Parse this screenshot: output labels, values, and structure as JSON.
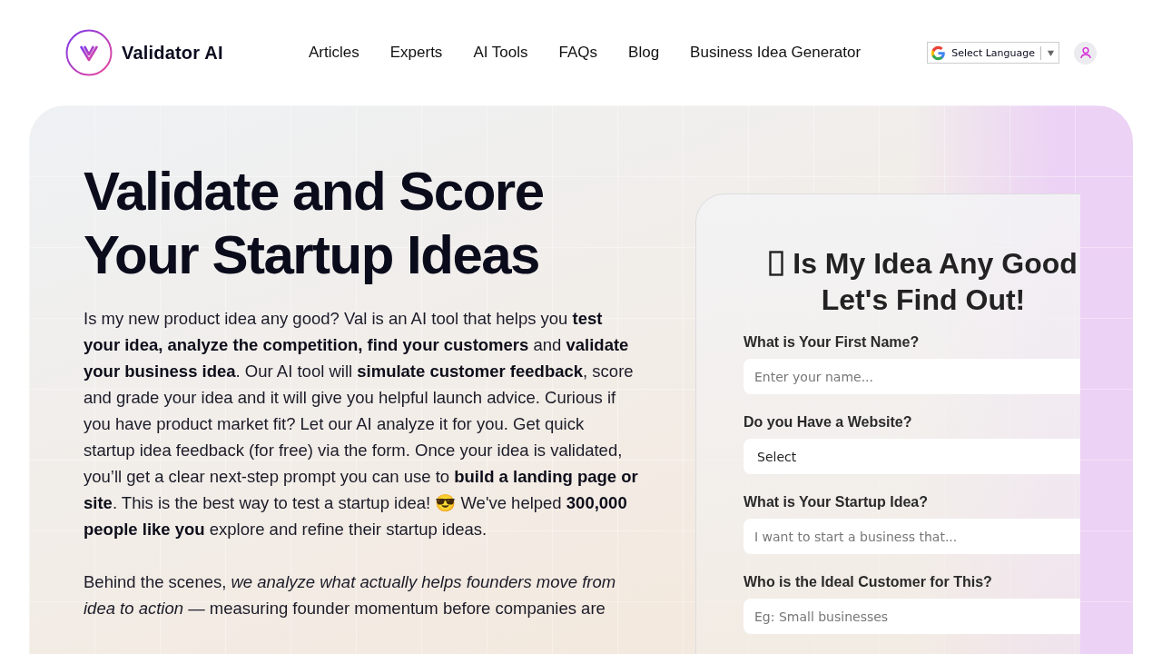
{
  "header": {
    "brand": "Validator AI",
    "nav": [
      "Articles",
      "Experts",
      "AI Tools",
      "FAQs",
      "Blog",
      "Business Idea Generator"
    ],
    "language_select": "Select Language"
  },
  "hero": {
    "title_lines": [
      "Validate and Score",
      "Your Startup Ideas"
    ],
    "paragraphs": [
      "Is my new product idea any good?   Val is an AI tool that helps you **test your idea, analyze the competition, find your customers** and **validate your business idea**.  Our AI tool will **simulate customer feedback**, score and grade your idea and it will give you helpful launch advice.  Curious if you have product market fit?  Let our AI analyze it for you.  Get quick startup idea feedback (for free) via the form.  Once your idea is validated, you’ll get a clear next-step prompt you can use to **build a landing page or site**.  This is the best way to test a startup idea!   😎 We've helped **300,000 people like you** explore and refine their startup ideas.",
      "Behind the scenes, *we analyze what actually helps founders move from idea to action* — measuring founder momentum before companies are"
    ]
  },
  "form": {
    "title_lines": [
      "Is My Idea Any Good",
      "Let's Find Out!"
    ],
    "fields": [
      {
        "kind": "input",
        "label": "What is Your First Name?",
        "placeholder": "Enter your name..."
      },
      {
        "kind": "select",
        "label": "Do you Have a Website?",
        "value": "Select"
      },
      {
        "kind": "input",
        "label": "What is Your Startup Idea?",
        "placeholder": "I want to start a business that..."
      },
      {
        "kind": "input",
        "label": "Who is the Ideal Customer for This?",
        "placeholder": "Eg: Small businesses"
      }
    ]
  }
}
